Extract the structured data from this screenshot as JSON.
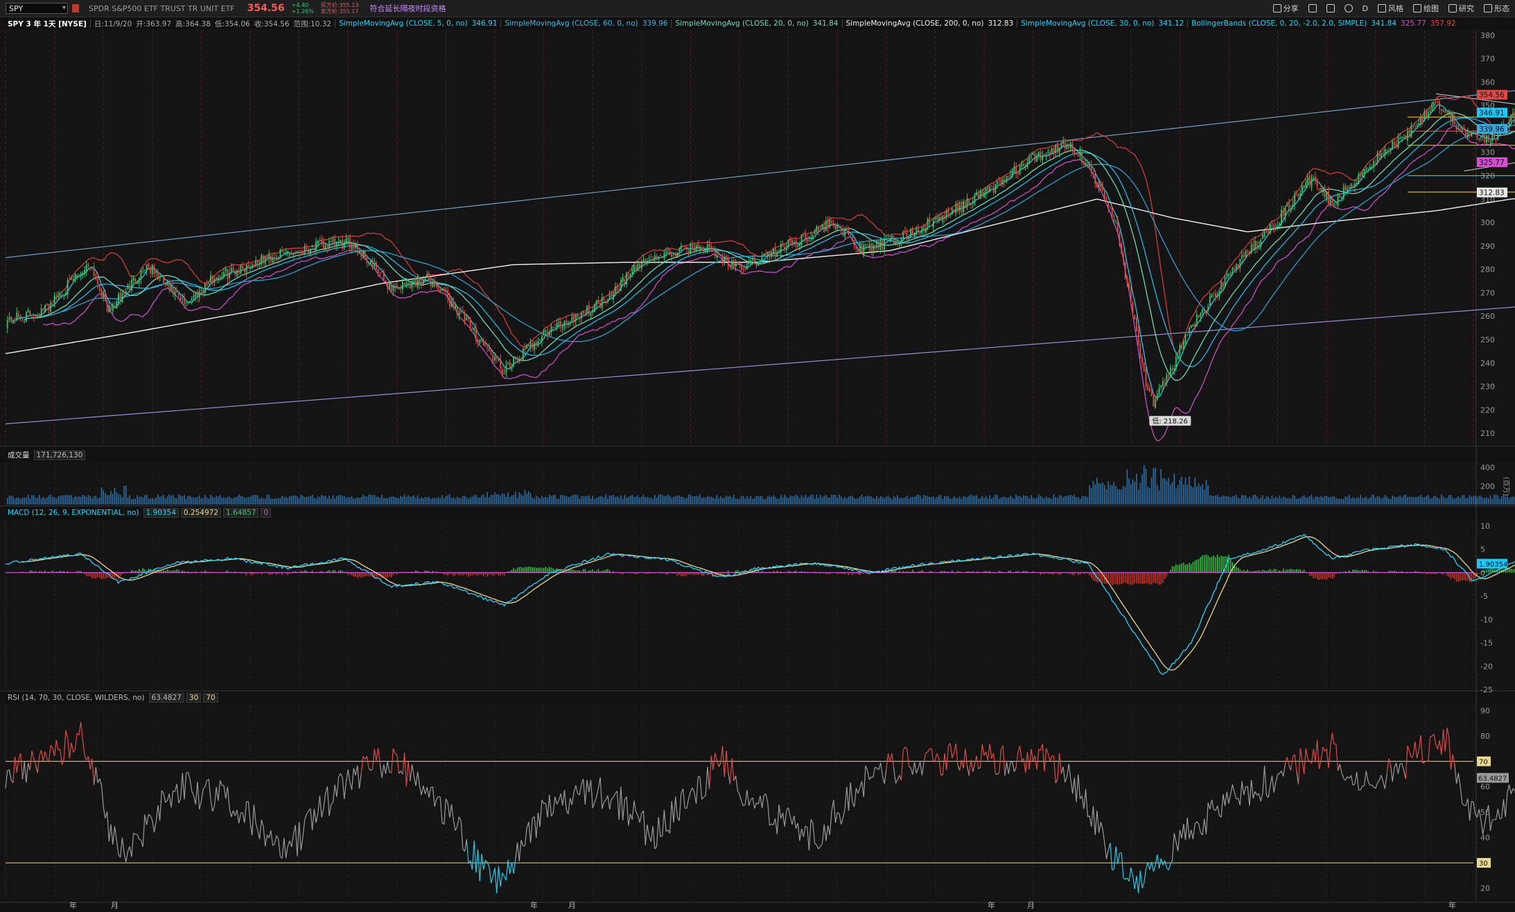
{
  "toolbar": {
    "symbol": "SPY",
    "description": "SPDR S&P500 ETF TRUST TR UNIT ETF",
    "last": "354.56",
    "change": "+4.40",
    "change_pct": "+1.26%",
    "bid": "买方价:355.13",
    "ask": "卖方价:355.17",
    "extended_hours": "符合延长隔夜时段资格",
    "share": "分享",
    "period": "D",
    "style": "风格",
    "drawing": "绘图",
    "studies": "研究",
    "patterns": "形态"
  },
  "study_bar": {
    "title": "SPY 3 年 1天 [NYSE]",
    "date": "日:11/9/20",
    "open": "开:363.97",
    "high": "高:364.38",
    "low": "低:354.06",
    "close": "收:354.56",
    "range": "范围:10.32",
    "studies": [
      {
        "label": "SimpleMovingAvg (CLOSE, 5, 0, no)",
        "value": "346.91",
        "color": "#28d4ff"
      },
      {
        "label": "SimpleMovingAvg (CLOSE, 60, 0, no)",
        "value": "339.96",
        "color": "#3fb8e6"
      },
      {
        "label": "SimpleMovingAvg (CLOSE, 20, 0, no)",
        "value": "341.84",
        "color": "#7ad8c0"
      },
      {
        "label": "SimpleMovingAvg (CLOSE, 200, 0, no)",
        "value": "312.83",
        "color": "#f0f0f0"
      },
      {
        "label": "SimpleMovingAvg (CLOSE, 30, 0, no)",
        "value": "341.12",
        "color": "#28d4ff"
      },
      {
        "label": "BollingerBands (CLOSE, 0, 20, -2.0, 2.0, SIMPLE)",
        "value": "341.84",
        "color": "#28d4ff"
      }
    ],
    "bb_lower": "325.77",
    "bb_upper": "357.92"
  },
  "price_axis": {
    "ticks": [
      "380",
      "370",
      "360",
      "350",
      "340",
      "330",
      "320",
      "310",
      "300",
      "290",
      "280",
      "270",
      "260",
      "250",
      "240",
      "230",
      "220",
      "210"
    ],
    "badges": [
      {
        "text": "354.56",
        "value": 354.56,
        "color": "#e04848"
      },
      {
        "text": "346.91",
        "value": 346.91,
        "color": "#1ec8ff"
      },
      {
        "text": "339.96",
        "value": 339.96,
        "color": "#3aa8e0"
      },
      {
        "text": "325.77",
        "value": 325.77,
        "color": "#d24fd2"
      },
      {
        "text": "312.83",
        "value": 312.83,
        "color": "#e8e8e8"
      }
    ]
  },
  "annotations": {
    "high_label": "高: 364.38",
    "low_label": "低: 218.26"
  },
  "volume": {
    "label": "成交量",
    "value": "171,726,130",
    "ticks": [
      "400",
      "200"
    ],
    "unit": "(百万)"
  },
  "macd": {
    "label": "MACD (12, 26, 9, EXPONENTIAL, no)",
    "value": "1.90354",
    "avg": "0.254972",
    "diff": "1.64857",
    "zero": "0",
    "ticks": [
      "10",
      "5",
      "0",
      "-5",
      "-10",
      "-15",
      "-20",
      "-25"
    ],
    "badge": "1.90354"
  },
  "rsi": {
    "label": "RSI (14, 70, 30, CLOSE, WILDERS, no)",
    "value": "63.4827",
    "oversold": "30",
    "overbought": "70",
    "ticks": [
      "90",
      "80",
      "70",
      "60",
      "50",
      "40",
      "30",
      "20"
    ],
    "badge": "63.4827"
  },
  "time_axis": {
    "labels": [
      {
        "text": "年",
        "key": "y1"
      },
      {
        "text": "月",
        "key": "m1"
      },
      {
        "text": "年",
        "key": "y2"
      },
      {
        "text": "月",
        "key": "m2"
      },
      {
        "text": "年",
        "key": "y3"
      },
      {
        "text": "月",
        "key": "m3"
      },
      {
        "text": "年",
        "key": "y4"
      }
    ]
  },
  "chart_data": {
    "type": "line",
    "title": "SPY 3 年 1天 [NYSE]",
    "x_range_days": 780,
    "price_ylim": [
      205,
      382
    ],
    "close_series_keypoints": [
      [
        0,
        258
      ],
      [
        20,
        262
      ],
      [
        45,
        283
      ],
      [
        55,
        262
      ],
      [
        75,
        282
      ],
      [
        95,
        265
      ],
      [
        110,
        276
      ],
      [
        140,
        285
      ],
      [
        165,
        290
      ],
      [
        185,
        291
      ],
      [
        205,
        272
      ],
      [
        225,
        276
      ],
      [
        240,
        263
      ],
      [
        265,
        236
      ],
      [
        285,
        252
      ],
      [
        315,
        265
      ],
      [
        340,
        284
      ],
      [
        370,
        290
      ],
      [
        390,
        280
      ],
      [
        410,
        288
      ],
      [
        440,
        300
      ],
      [
        455,
        288
      ],
      [
        475,
        293
      ],
      [
        500,
        303
      ],
      [
        525,
        315
      ],
      [
        545,
        327
      ],
      [
        565,
        334
      ],
      [
        575,
        325
      ],
      [
        590,
        300
      ],
      [
        605,
        235
      ],
      [
        610,
        222
      ],
      [
        630,
        255
      ],
      [
        650,
        278
      ],
      [
        670,
        295
      ],
      [
        695,
        320
      ],
      [
        705,
        308
      ],
      [
        725,
        325
      ],
      [
        745,
        338
      ],
      [
        760,
        352
      ],
      [
        775,
        338
      ],
      [
        790,
        335
      ],
      [
        800,
        345
      ],
      [
        815,
        340
      ],
      [
        822,
        328
      ],
      [
        835,
        345
      ],
      [
        842,
        354.56
      ]
    ],
    "sma200_keypoints": [
      [
        0,
        244
      ],
      [
        60,
        252
      ],
      [
        130,
        262
      ],
      [
        200,
        274
      ],
      [
        270,
        282
      ],
      [
        330,
        283
      ],
      [
        400,
        283
      ],
      [
        470,
        288
      ],
      [
        540,
        302
      ],
      [
        580,
        310
      ],
      [
        620,
        302
      ],
      [
        660,
        296
      ],
      [
        700,
        300
      ],
      [
        760,
        305
      ],
      [
        800,
        310
      ],
      [
        842,
        312.83
      ]
    ],
    "channel_upper": {
      "from": [
        0,
        285
      ],
      "to": [
        900,
        365
      ]
    },
    "channel_lower": {
      "from": [
        0,
        214
      ],
      "to": [
        900,
        270
      ]
    },
    "horizontal_levels": [
      {
        "value": 345,
        "color": "#e0b020"
      },
      {
        "value": 339,
        "color": "#e04040"
      },
      {
        "value": 333,
        "color": "#e0b020"
      },
      {
        "value": 320,
        "color": "#3fb8e6"
      },
      {
        "value": 313,
        "color": "#e0b020"
      }
    ],
    "high": 364.38,
    "low": 218.26,
    "macd_ylim": [
      -25,
      11
    ],
    "macd_keypoints": [
      [
        0,
        2
      ],
      [
        40,
        4
      ],
      [
        60,
        -2
      ],
      [
        90,
        2
      ],
      [
        120,
        3
      ],
      [
        150,
        1
      ],
      [
        180,
        3
      ],
      [
        205,
        -3
      ],
      [
        230,
        -2
      ],
      [
        265,
        -7
      ],
      [
        290,
        0
      ],
      [
        320,
        4
      ],
      [
        350,
        3
      ],
      [
        380,
        -1
      ],
      [
        400,
        1
      ],
      [
        430,
        2
      ],
      [
        460,
        0
      ],
      [
        490,
        2
      ],
      [
        520,
        3
      ],
      [
        545,
        4
      ],
      [
        575,
        2
      ],
      [
        595,
        -10
      ],
      [
        615,
        -22
      ],
      [
        630,
        -15
      ],
      [
        650,
        3
      ],
      [
        670,
        5
      ],
      [
        690,
        8
      ],
      [
        705,
        3
      ],
      [
        725,
        5
      ],
      [
        750,
        6
      ],
      [
        765,
        5
      ],
      [
        780,
        -2
      ],
      [
        800,
        2
      ],
      [
        815,
        3
      ],
      [
        822,
        -2
      ],
      [
        842,
        1.9
      ]
    ],
    "rsi_ylim": [
      15,
      92
    ],
    "rsi_overbought": 70,
    "rsi_oversold": 30,
    "rsi_keypoints": [
      [
        0,
        65
      ],
      [
        20,
        70
      ],
      [
        40,
        80
      ],
      [
        55,
        45
      ],
      [
        65,
        32
      ],
      [
        90,
        60
      ],
      [
        120,
        55
      ],
      [
        150,
        35
      ],
      [
        180,
        62
      ],
      [
        205,
        72
      ],
      [
        230,
        55
      ],
      [
        255,
        25
      ],
      [
        265,
        22
      ],
      [
        290,
        55
      ],
      [
        320,
        58
      ],
      [
        345,
        40
      ],
      [
        380,
        70
      ],
      [
        400,
        52
      ],
      [
        430,
        40
      ],
      [
        460,
        65
      ],
      [
        490,
        72
      ],
      [
        520,
        70
      ],
      [
        545,
        72
      ],
      [
        565,
        65
      ],
      [
        590,
        30
      ],
      [
        605,
        22
      ],
      [
        625,
        40
      ],
      [
        650,
        55
      ],
      [
        680,
        65
      ],
      [
        705,
        75
      ],
      [
        720,
        60
      ],
      [
        745,
        70
      ],
      [
        765,
        80
      ],
      [
        775,
        52
      ],
      [
        790,
        45
      ],
      [
        805,
        62
      ],
      [
        815,
        50
      ],
      [
        822,
        38
      ],
      [
        842,
        63.48
      ]
    ]
  }
}
